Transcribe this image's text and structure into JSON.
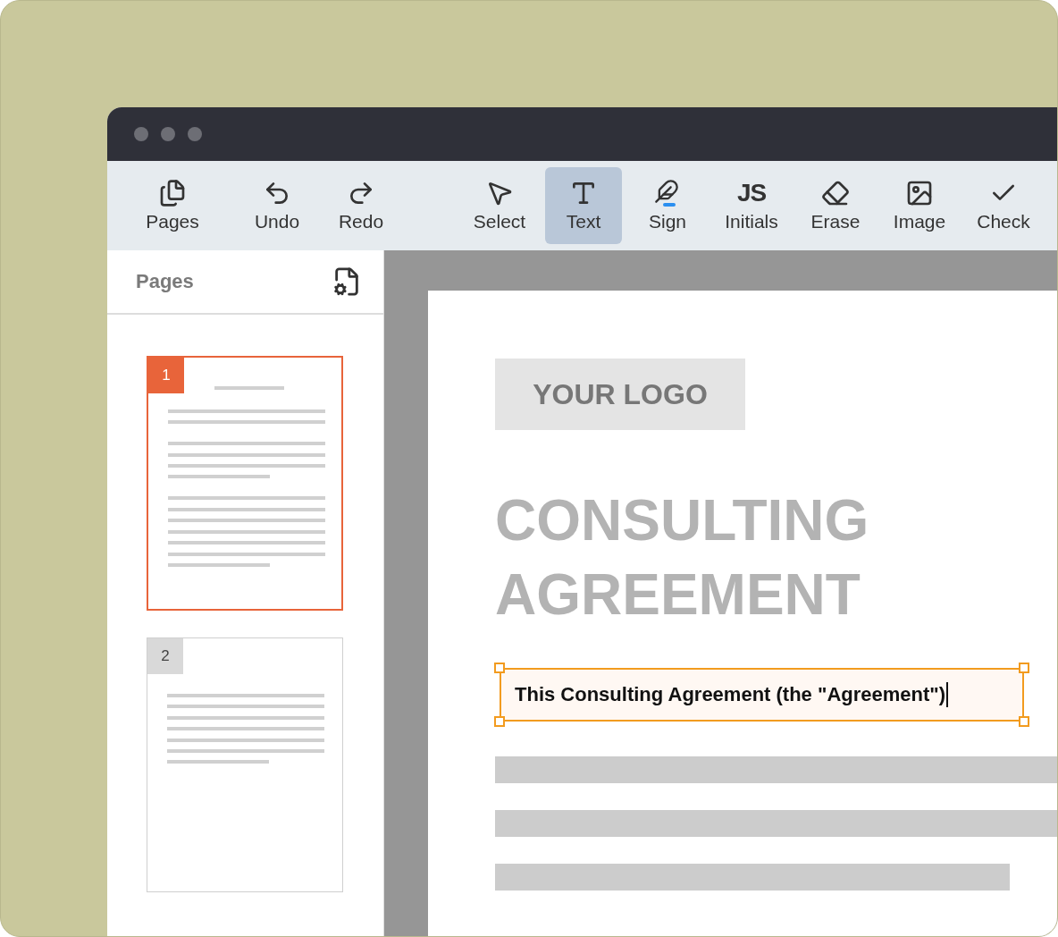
{
  "toolbar": {
    "tools": [
      {
        "kind": "pages",
        "label": "Pages",
        "selected": false
      },
      {
        "kind": "undo",
        "label": "Undo",
        "selected": false
      },
      {
        "kind": "redo",
        "label": "Redo",
        "selected": false
      },
      {
        "kind": "select",
        "label": "Select",
        "selected": false
      },
      {
        "kind": "text",
        "label": "Text",
        "selected": true
      },
      {
        "kind": "sign",
        "label": "Sign",
        "selected": false
      },
      {
        "kind": "initials",
        "label": "Initials",
        "glyph": "JS",
        "selected": false
      },
      {
        "kind": "erase",
        "label": "Erase",
        "selected": false
      },
      {
        "kind": "image",
        "label": "Image",
        "selected": false
      },
      {
        "kind": "check",
        "label": "Check",
        "selected": false
      }
    ]
  },
  "sidebar": {
    "title": "Pages",
    "thumbnails": [
      {
        "number": "1",
        "selected": true
      },
      {
        "number": "2",
        "selected": false
      }
    ]
  },
  "document": {
    "logo": "YOUR LOGO",
    "title_lines": [
      "CONSULTING",
      "AGREEMENT"
    ],
    "text_field": {
      "value": "This Consulting Agreement (the \"Agreement\")"
    }
  }
}
